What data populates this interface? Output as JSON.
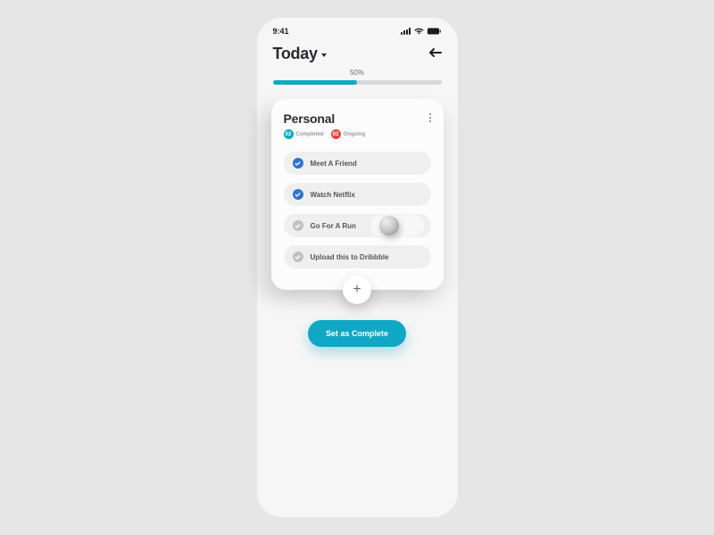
{
  "status": {
    "time": "9:41"
  },
  "header": {
    "title": "Today"
  },
  "progress": {
    "percent_label": "50%",
    "percent": 50
  },
  "card": {
    "title": "Personal",
    "stats": {
      "completed": {
        "count": "02",
        "label": "Completed"
      },
      "ongoing": {
        "count": "02",
        "label": "Ongoing"
      }
    },
    "tasks": [
      {
        "label": "Meet A Friend",
        "done": true
      },
      {
        "label": "Watch Netflix",
        "done": true
      },
      {
        "label": "Go For A Run",
        "done": false
      },
      {
        "label": "Upload this to Dribbble",
        "done": false
      }
    ]
  },
  "add_button": {
    "glyph": "+"
  },
  "complete_button": {
    "label": "Set as Complete"
  },
  "colors": {
    "accent": "#10a7c4",
    "done_check": "#2f74d0",
    "danger": "#e5443d"
  }
}
